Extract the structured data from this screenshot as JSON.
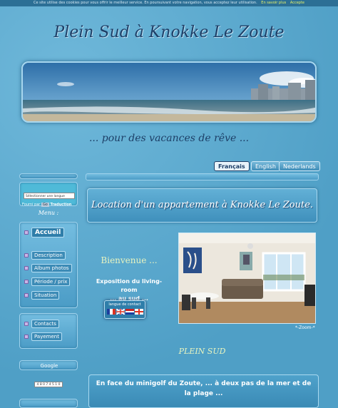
{
  "cookie": {
    "text": "Ce site utilise des cookies pour vous offrir le meilleur service. En poursuivant votre navigation, vous acceptez leur utilisation.",
    "more_label": "En savoir plus",
    "accept_label": "Accepte"
  },
  "header": {
    "title": "Plein Sud à Knokke Le Zoute",
    "subtitle": "... pour des vacances de rêve ..."
  },
  "languages": [
    {
      "label": "Français",
      "active": true
    },
    {
      "label": "English",
      "active": false
    },
    {
      "label": "Nederlands",
      "active": false
    }
  ],
  "sidebar": {
    "language_select": "Sélectionner une langue",
    "translate_prefix": "Fourni par",
    "translate_go": "Go",
    "translate_label": "Traduction",
    "menu_heading": "Menu :",
    "group1": [
      "Accueil",
      "Description",
      "Album photos",
      "Période / prix",
      "Situation"
    ],
    "group2": [
      "Contacts",
      "Payement"
    ],
    "google_label": "Google",
    "counter": "4 8 0 7 4 5 1 0"
  },
  "main": {
    "panel_title": "Location d'un appartement à Knokke Le Zoute.",
    "welcome": "Bienvenue ...",
    "expo_line1": "Exposition du living-room",
    "expo_line2": "... au sud ...",
    "lang_contact": "langue de contact",
    "zoom": "*-Zoom-*",
    "section_title": "PLEIN SUD",
    "intro_line1": "En face du minigolf du Zoute, ... à deux pas de la mer et de",
    "intro_line2": "la plage ..."
  },
  "colors": {
    "background": "#5aa9cf",
    "title": "#1d3f67",
    "accent": "#e8f4c0"
  }
}
